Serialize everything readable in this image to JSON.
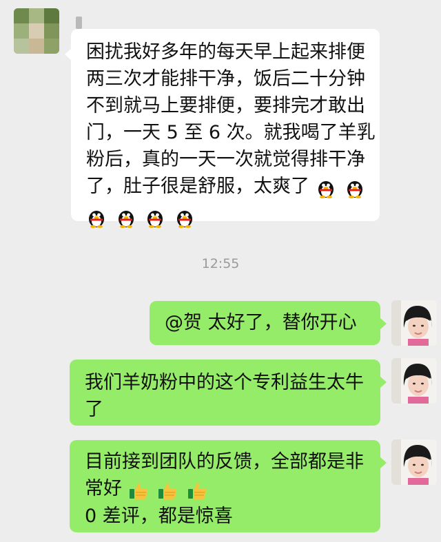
{
  "chat": {
    "msg1": {
      "lines": [
        "困扰我好多年的每天早上起来排便",
        "两三次才能排干净，饭后二十分钟",
        "不到就马上要排便，要排完才敢出",
        "门，一天 5 至 6 次。就我喝了羊乳",
        "粉后，真的一天一次就觉得排干净",
        "了，肚子很是舒服，太爽了"
      ],
      "emoji": "qq-penguin"
    },
    "timestamp": "12:55",
    "msg2": {
      "text": "@贺  太好了，替你开心"
    },
    "msg3": {
      "lines": [
        "我们羊奶粉中的这个专利益生太牛",
        "了"
      ]
    },
    "msg4": {
      "lines": [
        "目前接到团队的反馈，全部都是非",
        "常好",
        "0 差评，都是惊喜"
      ],
      "emoji": "thumbs-up"
    }
  },
  "colors": {
    "background": "#ededed",
    "incoming": "#ffffff",
    "outgoing": "#95ec69"
  }
}
